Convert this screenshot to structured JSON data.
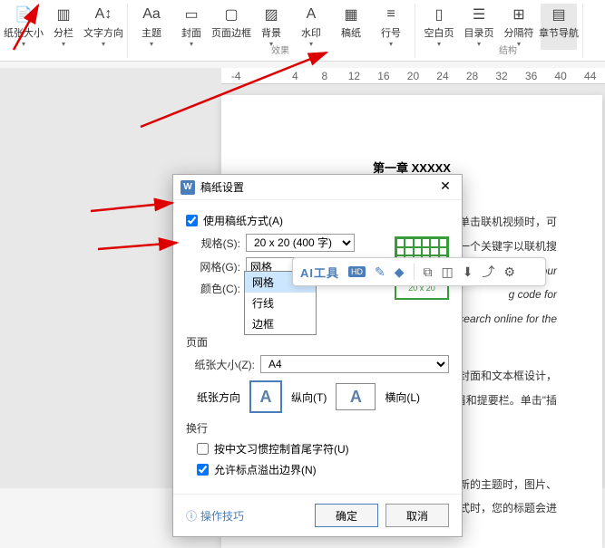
{
  "ribbon": {
    "items": [
      {
        "label": "纸张大小",
        "icon": "📄"
      },
      {
        "label": "分栏",
        "icon": "▥"
      },
      {
        "label": "文字方向",
        "icon": "A↕"
      },
      {
        "label": "主题",
        "icon": "Aa"
      },
      {
        "label": "封面",
        "icon": "▭"
      },
      {
        "label": "页面边框",
        "icon": "▢"
      },
      {
        "label": "背景",
        "icon": "▨"
      },
      {
        "label": "水印",
        "icon": "A"
      },
      {
        "label": "稿纸",
        "icon": "▦"
      },
      {
        "label": "行号",
        "icon": "≡"
      },
      {
        "label": "空白页",
        "icon": "▯"
      },
      {
        "label": "目录页",
        "icon": "☰"
      },
      {
        "label": "分隔符",
        "icon": "⊞"
      },
      {
        "label": "章节导航",
        "icon": "▤"
      }
    ],
    "group_effect": "效果",
    "group_struct": "结构"
  },
  "ruler": {
    "marks": [
      "-4",
      "",
      "4",
      "8",
      "12",
      "16",
      "20",
      "24",
      "28",
      "32",
      "36",
      "40",
      "44"
    ]
  },
  "page": {
    "title": "第一章  XXXXX",
    "paras": [
      "点。当您单击联机视频时，可",
      "可以键入一个关键字以联机搜",
      "rove  your",
      "g  code  for",
      "yword  to  search  online  for  the",
      "面、页脚、封面和文本框设计，",
      "面、页眉和提要栏。单击\"插",
      "设计并选择新的主题时，图片、",
      "前应用样式时，您的标题会进"
    ]
  },
  "dialog": {
    "title": "稿纸设置",
    "use_grid": "使用稿纸方式(A)",
    "spec_label": "规格(S):",
    "spec_value": "20 x 20 (400 字)",
    "grid_label": "网格(G):",
    "grid_value": "网格",
    "grid_options": [
      "网格",
      "行线",
      "边框"
    ],
    "color_label": "颜色(C):",
    "preview_label": "20 x 20",
    "page_section": "页面",
    "papersize_label": "纸张大小(Z):",
    "papersize_value": "A4",
    "orient_label": "纸张方向",
    "portrait": "纵向(T)",
    "landscape": "横向(L)",
    "wrap_section": "换行",
    "wrap_chk1": "按中文习惯控制首尾字符(U)",
    "wrap_chk2": "允许标点溢出边界(N)",
    "tips": "操作技巧",
    "ok": "确定",
    "cancel": "取消"
  },
  "floatbar": {
    "ai": "AI工具",
    "hd": "HD"
  }
}
